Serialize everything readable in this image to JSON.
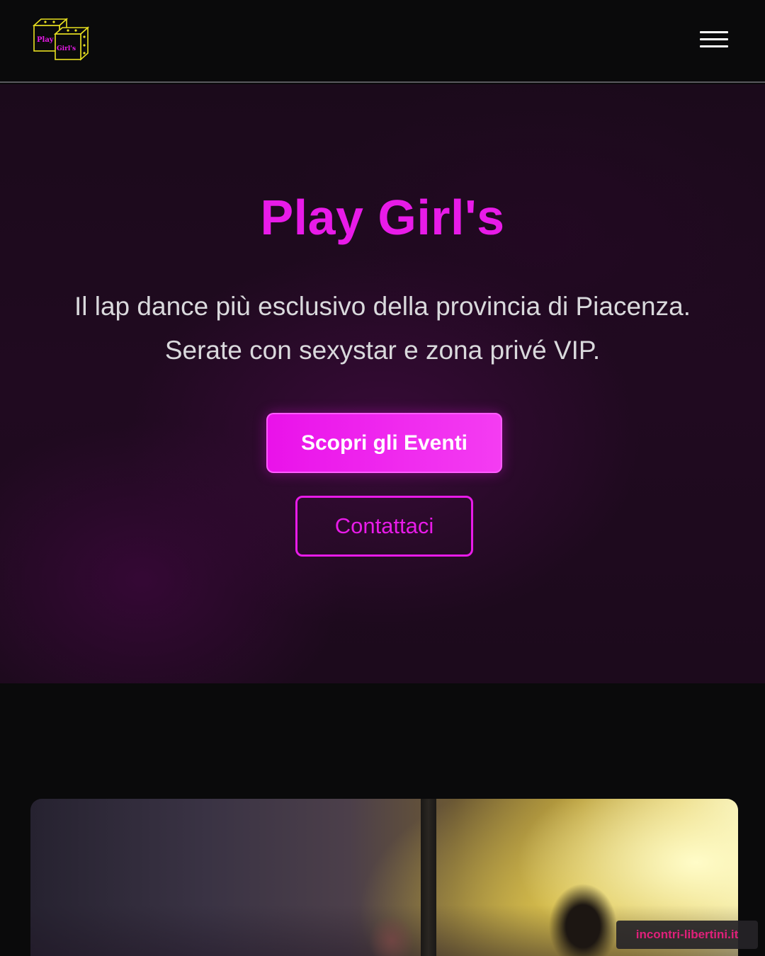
{
  "header": {
    "logo_text_top": "Play",
    "logo_text_bottom": "Girl's",
    "menu_icon": "hamburger-menu-icon"
  },
  "hero": {
    "title": "Play Girl's",
    "subtitle_line1": "Il lap dance più esclusivo della provincia di Piacenza.",
    "subtitle_line2": "Serate con sexystar e zona privé VIP.",
    "primary_button": "Scopri gli Eventi",
    "secondary_button": "Contattaci"
  },
  "watermark": "incontri-libertini.it",
  "colors": {
    "accent": "#e81be8",
    "background": "#0a0a0b",
    "logo_outline": "#e8e020"
  }
}
